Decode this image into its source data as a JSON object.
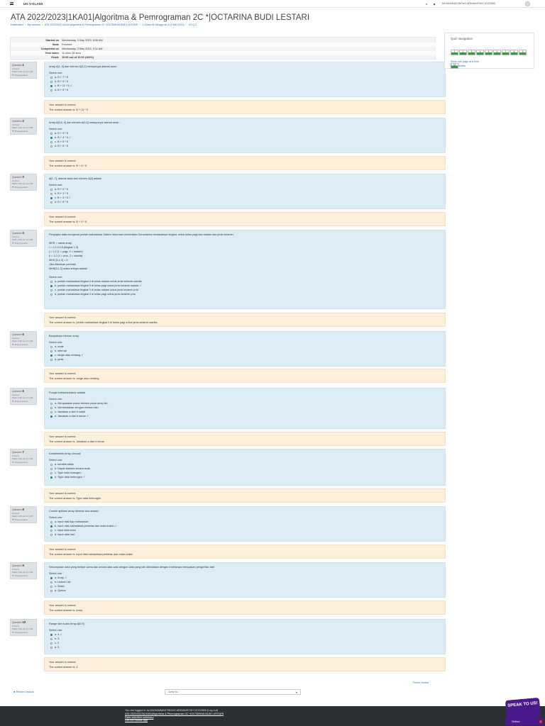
{
  "topbar": {
    "brand": "UG V-CLASS",
    "user": "MUHAMMAD RIDHO ARDIANSYAH 10122860"
  },
  "page_title": "ATA 2022/2023|1KA01|Algoritma & Pemrograman 2C *|OCTARINA BUDI LESTARI",
  "breadcrumb": [
    "Dashboard",
    "My courses",
    "ATA 2022/2023 1KA01|Algoritma & Pemrograman 2C *|OCTARINA BUDI LESTARI",
    "V-Class #2 Minggu ke-8 (3 Mei 2023)",
    "V2-Q 2"
  ],
  "summary": [
    {
      "k": "Started on",
      "v": "Wednesday, 3 May 2023, 8:59 AM"
    },
    {
      "k": "State",
      "v": "Finished"
    },
    {
      "k": "Completed on",
      "v": "Wednesday, 3 May 2023, 9:11 AM"
    },
    {
      "k": "Time taken",
      "v": "11 mins 28 secs"
    },
    {
      "k": "Grade",
      "v": "10.00 out of 10.00 (100%)"
    }
  ],
  "qinfo_labels": {
    "question": "Question",
    "status": "Correct",
    "mark": "Mark 1.00 out of 1.00",
    "flag": "Flag question"
  },
  "select_one": "Select one:",
  "feedback_correct": "Your answer is correct.",
  "questions": [
    {
      "no": "1",
      "prompt": "Array A[1..5] dan elemen A[3,2] mempunyai alamat awal :",
      "options": [
        {
          "t": "a. B + 7 * 5",
          "sel": false
        },
        {
          "t": "b. B + 3 * 5",
          "sel": false
        },
        {
          "t": "c. B + 11 * 5",
          "sel": true
        },
        {
          "t": "d. B + 5 * 5",
          "sel": false
        }
      ],
      "answer": "The correct answer is: B + 11 * 5"
    },
    {
      "no": "2",
      "prompt": "Array A[5,6..9] dan elemen A[0,3] mempunyai alamat awal :",
      "options": [
        {
          "t": "a. B + 3 * 5",
          "sel": false
        },
        {
          "t": "b. B + 4 * 5",
          "sel": true
        },
        {
          "t": "c. B + 5 * 5",
          "sel": false
        },
        {
          "t": "d. B + 6 * 5",
          "sel": false
        }
      ],
      "answer": "The correct answer is: B + 4 * 5"
    },
    {
      "no": "3",
      "prompt": "A[1..7], alamat awal dari elemen A[4] adalah",
      "options": [
        {
          "t": "a. B + 4 * 5",
          "sel": false
        },
        {
          "t": "b. B + 1 * 5",
          "sel": false
        },
        {
          "t": "c. B + 3 * 5",
          "sel": true
        },
        {
          "t": "d. B + 5 * 5",
          "sel": false
        }
      ],
      "answer": "The correct answer is: B + 3 * 5"
    },
    {
      "no": "4",
      "prompt": "Penyajian data mengenai jumlah mahasiswa Sistem Informasi Universitas Gunadarma berdasarkan tingkat, untuk kelas pagi dan malam dan jenis kelamin.",
      "extra": [
        "MHS = nama array",
        "i = 1,2,3,4,5 (tingkat 1-5)",
        "j = 1,2 (1 = pagi, 2 = malam)",
        "k = 1,2 (1 = pria, 2 = wanita)",
        "MHS [5,1,2] = 0",
        "Jika diberikan perintah",
        "MHS[3,1,2] maka artinya adalah"
      ],
      "options": [
        {
          "t": "a. jumlah mahasiswa tingkat 3 di kelas malam untuk jenis kelamin wanita",
          "sel": false
        },
        {
          "t": "b. jumlah mahasiswa tingkat 3 di kelas pagi untuk jenis kelamin wanita",
          "sel": true
        },
        {
          "t": "c. jumlah mahasiswa tingkat 3 di kelas malam untuk jenis kelamin pria",
          "sel": false
        },
        {
          "t": "d. jumlah mahasiswa tingkat 3 di kelas pagi untuk jenis kelamin pria",
          "sel": false
        }
      ],
      "answer": "The correct answer is: jumlah mahasiswa tingkat 3 di kelas pagi untuk jenis kelamin wanita"
    },
    {
      "no": "5",
      "prompt": "Banyaknya elemen array",
      "options": [
        {
          "t": "a. node",
          "sel": false
        },
        {
          "t": "b. internal",
          "sel": false
        },
        {
          "t": "c. range atau rentang",
          "sel": true
        },
        {
          "t": "d. jarak",
          "sel": false
        }
      ],
      "answer": "The correct answer is: range atau rentang"
    },
    {
      "no": "6",
      "prompt": "Fungsi indeks/subskrip adalah",
      "options": [
        {
          "t": "a. Menyatakan posisi elemen pada array tsb.",
          "sel": false
        },
        {
          "t": "b. Membedakan dengan elemen lain.",
          "sel": false
        },
        {
          "t": "c. Jawaban a dan b salah",
          "sel": false
        },
        {
          "t": "d. Jawaban a dan b benar",
          "sel": true
        }
      ],
      "answer": "The correct answer is: Jawaban a dan b benar"
    },
    {
      "no": "7",
      "prompt": "Karakteristik Array, kecuali",
      "options": [
        {
          "t": "a. bersifat statis",
          "sel": false
        },
        {
          "t": "b. Dapat diakses secara acak",
          "sel": false
        },
        {
          "t": "c. Type data homogen",
          "sel": false
        },
        {
          "t": "d. Type data heterogen",
          "sel": true
        }
      ],
      "answer": "The correct answer is: Type data heterogen"
    },
    {
      "no": "8",
      "prompt": "Contoh aplikasi array dimensi dua adalah",
      "options": [
        {
          "t": "a. input nilai tiap mahasiswa",
          "sel": false
        },
        {
          "t": "b. input nilai mahasiswa perkelas dan mata kuliah",
          "sel": true
        },
        {
          "t": "c. input data buku",
          "sel": false
        },
        {
          "t": "d. input data hari",
          "sel": false
        }
      ],
      "answer": "The correct answer is: input nilai mahasiswa perkelas dan mata kuliah"
    },
    {
      "no": "9",
      "prompt": "Sekumpulan data yang bertipe sama dan antara data satu dengan data yang lain dibedakan dengan indeksnya merupakan pengertian dari",
      "options": [
        {
          "t": "a. Array",
          "sel": true
        },
        {
          "t": "b. Linked List",
          "sel": false
        },
        {
          "t": "c. Stack",
          "sel": false
        },
        {
          "t": "d. Queue",
          "sel": false
        }
      ],
      "answer": "The correct answer is: Array"
    },
    {
      "no": "10",
      "prompt": "Range dari suatu Array A[0:9]",
      "options": [
        {
          "t": "a. 4",
          "sel": true
        },
        {
          "t": "b. 3",
          "sel": false
        },
        {
          "t": "c. 2",
          "sel": false
        },
        {
          "t": "d. 5",
          "sel": false
        }
      ],
      "answer": "The correct answer is: 4"
    }
  ],
  "qnav": {
    "title": "Quiz navigation",
    "buttons": [
      "1",
      "2",
      "3",
      "4",
      "5",
      "6",
      "7",
      "8",
      "9",
      "10"
    ],
    "link1": "Show one page at a time",
    "link2": "Finish review"
  },
  "finish_review": "Finish review",
  "return_link": "◄ Return Diskusi",
  "jump_placeholder": "Jump to...",
  "footer": {
    "line1": "You are logged in as MUHAMMAD RIDHO ARDIANSYAH 10122860 (Log out)",
    "line2": "ATA 2022/2023|1KA01|Algoritma & Pemrograman 2C *|OCTARINA BUDI LESTARI",
    "line3": "Data retention summary",
    "line4": "Get the mobile app"
  },
  "speak": "SPEAK TO US!",
  "online": "Online",
  "colors": {
    "accent": "#2a6ebb",
    "correct": "#3a9b3a",
    "qbody": "#dcedf5",
    "feedback": "#fcefdc"
  }
}
